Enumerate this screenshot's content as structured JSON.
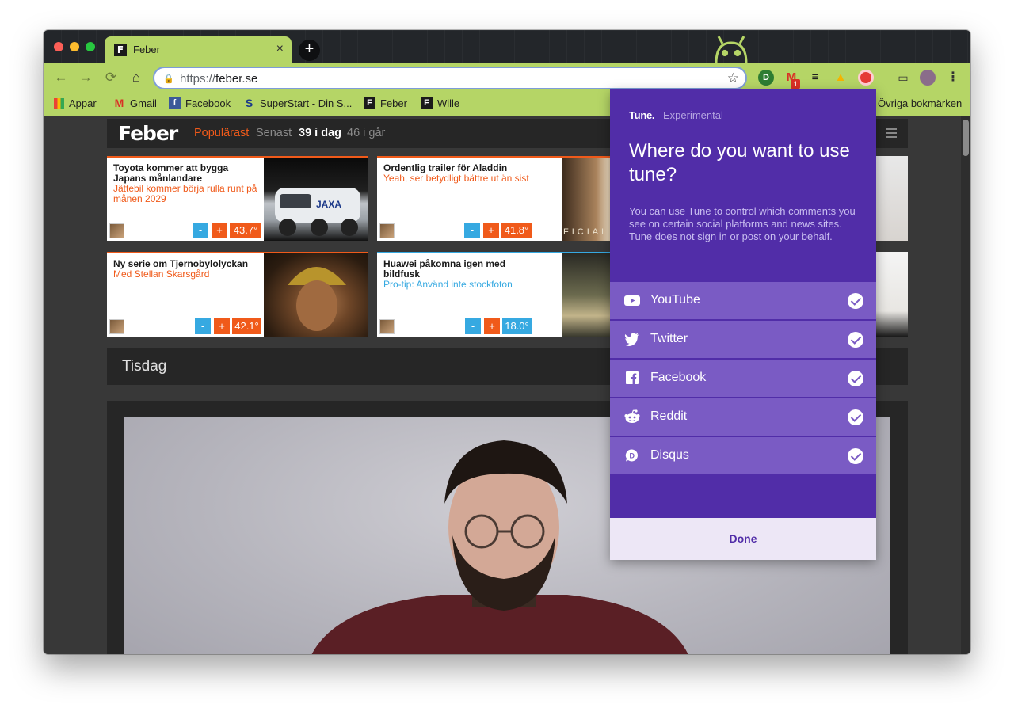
{
  "browser": {
    "tab": {
      "favicon": "F",
      "title": "Feber",
      "close": "×"
    },
    "new_tab": "+",
    "url_scheme": "https://",
    "url_host": "feber.se",
    "star": "☆",
    "extensions": [
      {
        "icon": "ghostery-icon",
        "label": "D",
        "bg": "#2e7d32"
      },
      {
        "icon": "gmail-icon",
        "label": "1",
        "bg": "#d93025"
      },
      {
        "icon": "buffer-icon",
        "label": "≡",
        "bg": "#222222"
      },
      {
        "icon": "drive-icon",
        "label": "▲",
        "bg": "#f4b400"
      },
      {
        "icon": "tune-icon",
        "label": "●",
        "bg": "#e53935"
      },
      {
        "icon": "cast-icon",
        "label": "▭",
        "bg": "transparent"
      },
      {
        "icon": "profile-avatar",
        "label": "",
        "bg": "#8a6d8a"
      },
      {
        "icon": "menu-dots-icon",
        "label": "⋮",
        "bg": "transparent"
      }
    ]
  },
  "bookmarks": {
    "items": [
      {
        "label": "Appar",
        "icon": "apps-grid-icon"
      },
      {
        "label": "Gmail",
        "icon": "gmail-icon",
        "glyph": "M"
      },
      {
        "label": "Facebook",
        "icon": "facebook-icon",
        "glyph": "f"
      },
      {
        "label": "SuperStart - Din S...",
        "icon": "superstart-icon",
        "glyph": "S"
      },
      {
        "label": "Feber",
        "icon": "feber-icon",
        "glyph": "F"
      },
      {
        "label": "Wille",
        "icon": "feber-icon",
        "glyph": "F"
      }
    ],
    "other": "Övriga bokmärken"
  },
  "feber": {
    "logo": "Feber",
    "nav": {
      "popular": "Populärast",
      "latest": "Senast",
      "today": "39 i dag",
      "yesterday": "46 i går"
    },
    "cards": [
      {
        "title": "Toyota kommer att bygga Japans månlandare",
        "sub": "Jättebil kommer börja rulla runt på månen 2029",
        "subcolor": "#f05a1a",
        "border": "#f05a1a",
        "temp": "43.7°",
        "tempcolor": "#f05a1a"
      },
      {
        "title": "Ordentlig trailer för Aladdin",
        "sub": "Yeah, ser betydligt bättre ut än sist",
        "subcolor": "#f05a1a",
        "border": "#f05a1a",
        "temp": "41.8°",
        "tempcolor": "#f05a1a",
        "overlay": "FICIAL TR"
      },
      {
        "title": "Ny serie om Tjernobylolyckan",
        "sub": "Med Stellan Skarsgård",
        "subcolor": "#f05a1a",
        "border": "#f05a1a",
        "temp": "42.1°",
        "tempcolor": "#f05a1a"
      },
      {
        "title": "Huawei påkomna igen med bildfusk",
        "sub": "Pro-tip: Använd inte stockfoton",
        "subcolor": "#36a9e1",
        "border": "#36a9e1",
        "temp": "18.0°",
        "tempcolor": "#36a9e1"
      }
    ],
    "vote_minus": "-",
    "vote_plus": "+",
    "day": "Tisdag"
  },
  "tune_popup": {
    "brand": "Tune.",
    "experimental": "Experimental",
    "heading": "Where do you want to use tune?",
    "description": "You can use Tune to control which comments you see on certain social platforms and news sites. Tune does not sign in or post on your behalf.",
    "platforms": [
      {
        "label": "YouTube",
        "icon": "youtube-icon",
        "checked": true
      },
      {
        "label": "Twitter",
        "icon": "twitter-icon",
        "checked": true
      },
      {
        "label": "Facebook",
        "icon": "facebook-icon",
        "checked": true
      },
      {
        "label": "Reddit",
        "icon": "reddit-icon",
        "checked": true
      },
      {
        "label": "Disqus",
        "icon": "disqus-icon",
        "checked": true
      }
    ],
    "done": "Done"
  }
}
